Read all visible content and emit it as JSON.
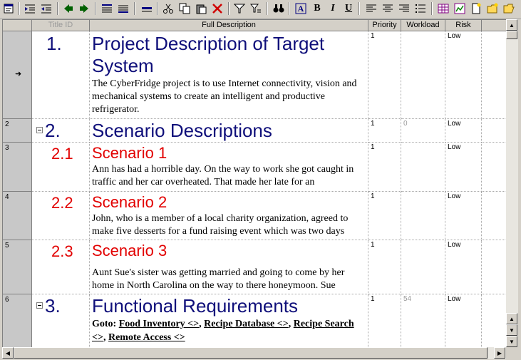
{
  "columns": {
    "title_id": "Title ID",
    "full_description": "Full Description",
    "priority": "Priority",
    "workload": "Workload",
    "risk": "Risk"
  },
  "icons": [
    "properties-icon",
    "indent-icon",
    "outdent-icon",
    "arrow-left-icon",
    "arrow-right-icon",
    "align-left-icon",
    "align-justify-icon",
    "line-icon",
    "cut-icon",
    "copy-icon",
    "paste-icon",
    "delete-icon",
    "filter-icon",
    "sort-icon",
    "find-icon",
    "font-color-icon",
    "bold-icon",
    "italic-icon",
    "underline-icon",
    "align-left-icon",
    "align-center-icon",
    "align-right-icon",
    "bullets-icon",
    "table-icon",
    "chart-icon",
    "new-document-icon",
    "new-folder-icon",
    "open-folder-icon"
  ],
  "toolbar": {
    "bold": "B",
    "italic": "I",
    "underline": "U"
  },
  "rows": [
    {
      "row_number": "",
      "pointer": "➜",
      "title_id": "1.",
      "title": "Project Description of Target System",
      "description": "The CyberFridge project is to use Internet connectivity, vision and mechanical systems to create an intelligent and productive refrigerator.",
      "priority": "1",
      "workload": "",
      "risk": "Low"
    },
    {
      "row_number": "2",
      "title_id": "2.",
      "title": "Scenario Descriptions",
      "description": "",
      "priority": "1",
      "workload": "0",
      "risk": "Low"
    },
    {
      "row_number": "3",
      "title_id": "2.1",
      "title": "Scenario 1",
      "description": "Ann has had a horrible day. On the way to work she got caught in traffic and her car overheated. That made her late for an",
      "priority": "1",
      "workload": "",
      "risk": "Low"
    },
    {
      "row_number": "4",
      "title_id": "2.2",
      "title": "Scenario 2",
      "description": "John, who is a member of a local charity organization, agreed to make five desserts for a fund raising event which was two days",
      "priority": "1",
      "workload": "",
      "risk": "Low"
    },
    {
      "row_number": "5",
      "title_id": "2.3",
      "title": "Scenario 3",
      "description": "Aunt Sue's sister was getting married and going to come by her home in North Carolina on the way to there honeymoon. Sue",
      "priority": "1",
      "workload": "",
      "risk": "Low"
    },
    {
      "row_number": "6",
      "title_id": "3.",
      "title": "Functional Requirements",
      "goto_label": "Goto:",
      "goto_links": [
        "Food Inventory <>",
        "Recipe Database <>",
        "Recipe Search <>",
        "Remote Access <>"
      ],
      "priority": "1",
      "workload": "54",
      "risk": "Low"
    }
  ],
  "scroll": {
    "up": "▲",
    "down": "▼",
    "left": "◀",
    "right": "▶"
  }
}
